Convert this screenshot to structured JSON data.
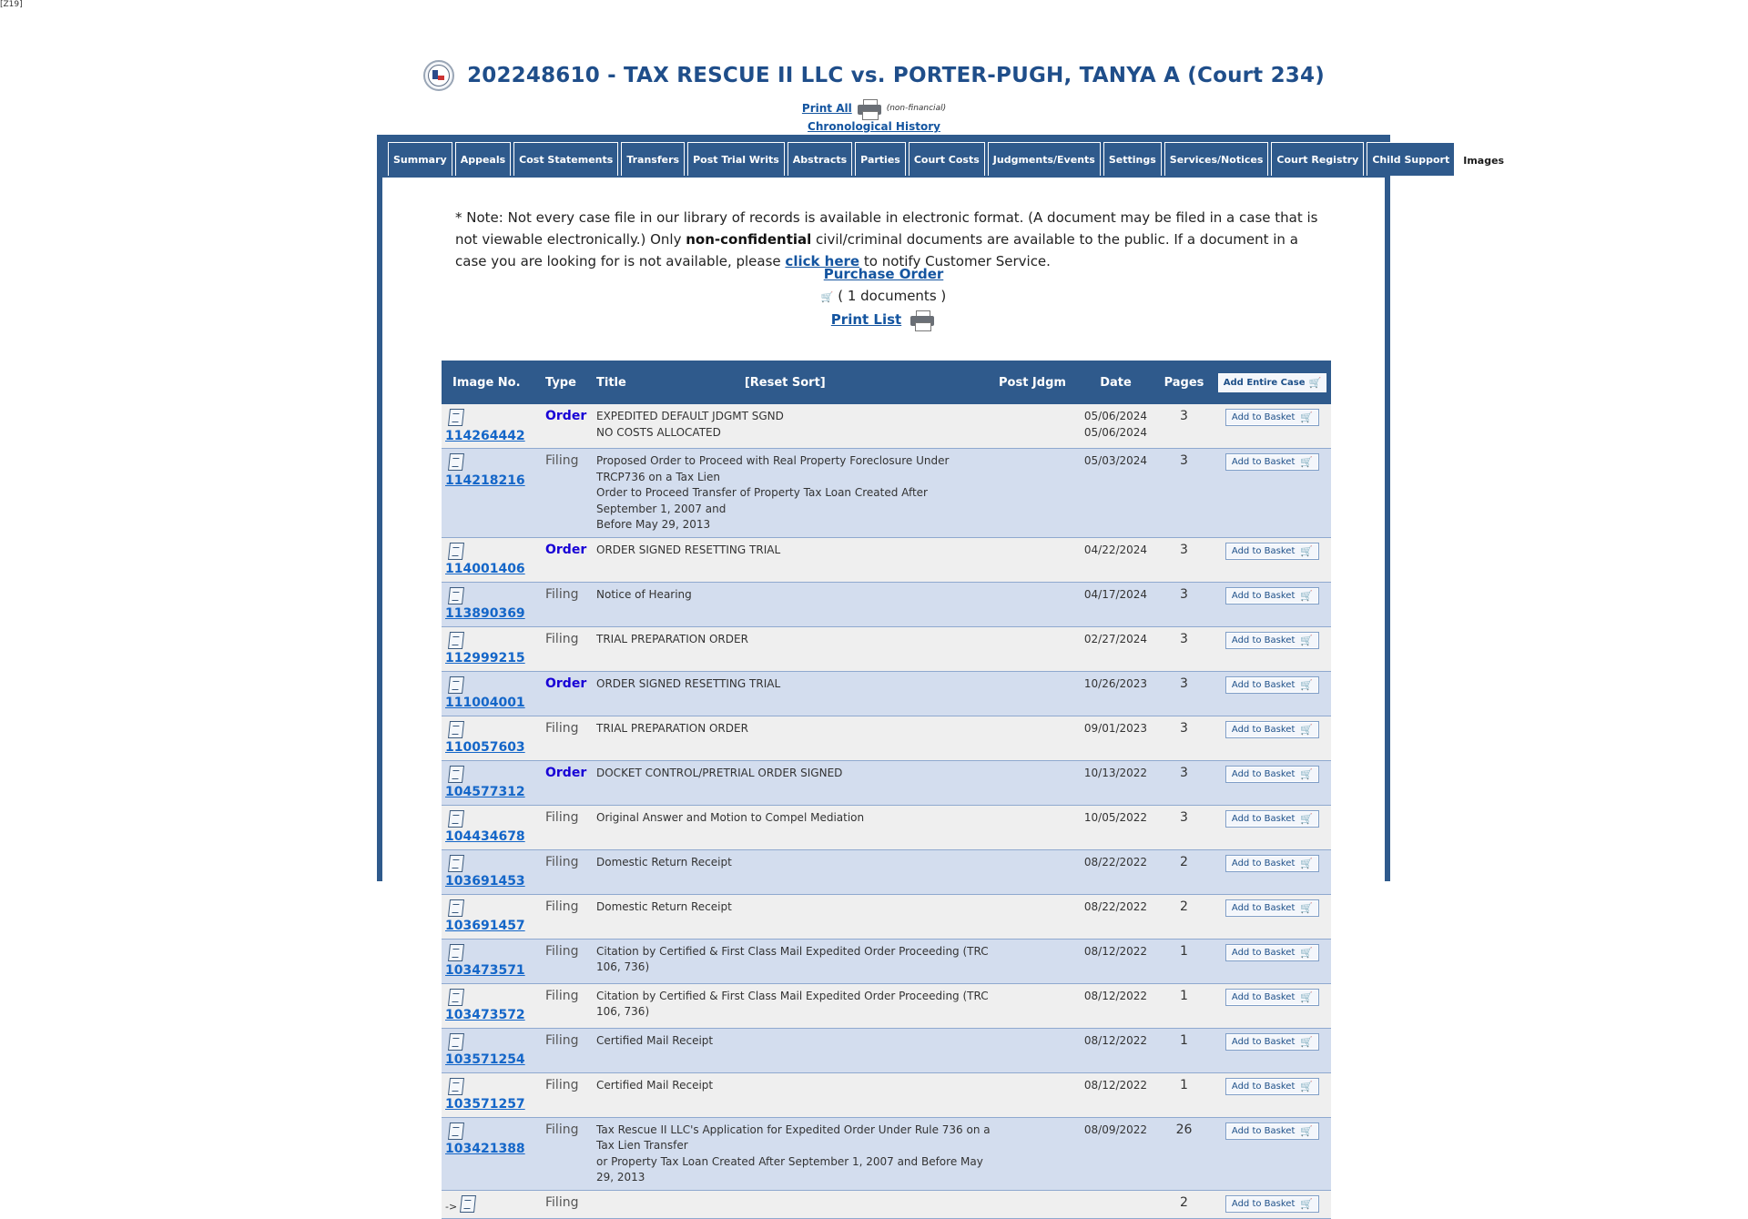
{
  "corner_tag": "[Z19]",
  "header": {
    "case_title": "202248610 - TAX RESCUE II LLC vs. PORTER-PUGH, TANYA A (Court 234)",
    "print_all": "Print All",
    "non_financial": "(non-financial)",
    "chronological_history": "Chronological History"
  },
  "tabs": [
    {
      "label": "Summary",
      "active": false
    },
    {
      "label": "Appeals",
      "active": false
    },
    {
      "label": "Cost Statements",
      "active": false
    },
    {
      "label": "Transfers",
      "active": false
    },
    {
      "label": "Post Trial Writs",
      "active": false
    },
    {
      "label": "Abstracts",
      "active": false
    },
    {
      "label": "Parties",
      "active": false
    },
    {
      "label": "Court Costs",
      "active": false
    },
    {
      "label": "Judgments/Events",
      "active": false
    },
    {
      "label": "Settings",
      "active": false
    },
    {
      "label": "Services/Notices",
      "active": false
    },
    {
      "label": "Court Registry",
      "active": false
    },
    {
      "label": "Child Support",
      "active": false
    },
    {
      "label": "Images",
      "active": true
    }
  ],
  "note": {
    "part1": "* Note: Not every case file in our library of records is available in electronic format. (A document may be filed in a case that is not viewable electronically.) Only ",
    "bold": "non-confidential",
    "part2": " civil/criminal documents are available to the public. If a document in a case you are looking for is not available, please ",
    "link": "click here",
    "part3": " to notify Customer Service."
  },
  "purchase_order": "Purchase Order",
  "basket_count": "( 1 documents )",
  "print_list": "Print List",
  "table": {
    "headers": {
      "image_no": "Image No.",
      "type": "Type",
      "title": "Title",
      "reset_sort": "[Reset Sort]",
      "post_jdgm": "Post Jdgm",
      "date": "Date",
      "pages": "Pages",
      "add_entire_case": "Add Entire Case"
    },
    "add_label": "Add to Basket",
    "rows": [
      {
        "image": "114264442",
        "type": "Order",
        "title": [
          "EXPEDITED DEFAULT JDGMT SGND",
          "NO COSTS ALLOCATED"
        ],
        "date": [
          "05/06/2024",
          "05/06/2024"
        ],
        "pages": "3"
      },
      {
        "image": "114218216",
        "type": "Filing",
        "title": [
          "Proposed Order to Proceed with Real Property Foreclosure Under TRCP736 on a Tax Lien",
          "Order to Proceed Transfer of Property Tax Loan Created After September 1, 2007 and",
          "Before May 29, 2013"
        ],
        "date": [
          "05/03/2024"
        ],
        "pages": "3"
      },
      {
        "image": "114001406",
        "type": "Order",
        "title": [
          "ORDER SIGNED RESETTING TRIAL"
        ],
        "date": [
          "04/22/2024"
        ],
        "pages": "3"
      },
      {
        "image": "113890369",
        "type": "Filing",
        "title": [
          "Notice of Hearing"
        ],
        "date": [
          "04/17/2024"
        ],
        "pages": "3"
      },
      {
        "image": "112999215",
        "type": "Filing",
        "title": [
          "TRIAL PREPARATION ORDER"
        ],
        "date": [
          "02/27/2024"
        ],
        "pages": "3"
      },
      {
        "image": "111004001",
        "type": "Order",
        "title": [
          "ORDER SIGNED RESETTING TRIAL"
        ],
        "date": [
          "10/26/2023"
        ],
        "pages": "3"
      },
      {
        "image": "110057603",
        "type": "Filing",
        "title": [
          "TRIAL PREPARATION ORDER"
        ],
        "date": [
          "09/01/2023"
        ],
        "pages": "3"
      },
      {
        "image": "104577312",
        "type": "Order",
        "title": [
          "DOCKET CONTROL/PRETRIAL ORDER SIGNED"
        ],
        "date": [
          "10/13/2022"
        ],
        "pages": "3"
      },
      {
        "image": "104434678",
        "type": "Filing",
        "title": [
          "Original Answer and Motion to Compel Mediation"
        ],
        "date": [
          "10/05/2022"
        ],
        "pages": "3"
      },
      {
        "image": "103691453",
        "type": "Filing",
        "title": [
          "Domestic Return Receipt"
        ],
        "date": [
          "08/22/2022"
        ],
        "pages": "2"
      },
      {
        "image": "103691457",
        "type": "Filing",
        "title": [
          "Domestic Return Receipt"
        ],
        "date": [
          "08/22/2022"
        ],
        "pages": "2"
      },
      {
        "image": "103473571",
        "type": "Filing",
        "title": [
          "Citation by Certified & First Class Mail Expedited Order Proceeding (TRC 106, 736)"
        ],
        "date": [
          "08/12/2022"
        ],
        "pages": "1"
      },
      {
        "image": "103473572",
        "type": "Filing",
        "title": [
          "Citation by Certified & First Class Mail Expedited Order Proceeding (TRC 106, 736)"
        ],
        "date": [
          "08/12/2022"
        ],
        "pages": "1"
      },
      {
        "image": "103571254",
        "type": "Filing",
        "title": [
          "Certified Mail Receipt"
        ],
        "date": [
          "08/12/2022"
        ],
        "pages": "1"
      },
      {
        "image": "103571257",
        "type": "Filing",
        "title": [
          "Certified Mail Receipt"
        ],
        "date": [
          "08/12/2022"
        ],
        "pages": "1"
      },
      {
        "image": "103421388",
        "type": "Filing",
        "title": [
          "Tax Rescue II LLC's Application for Expedited Order Under Rule 736 on a Tax Lien Transfer",
          "or Property Tax Loan Created After September 1, 2007 and Before May 29, 2013"
        ],
        "date": [
          "08/09/2022"
        ],
        "pages": "26"
      },
      {
        "image": "",
        "prefix": "->",
        "type": "Filing",
        "title": [
          ""
        ],
        "date": [
          ""
        ],
        "pages": "2"
      }
    ]
  }
}
